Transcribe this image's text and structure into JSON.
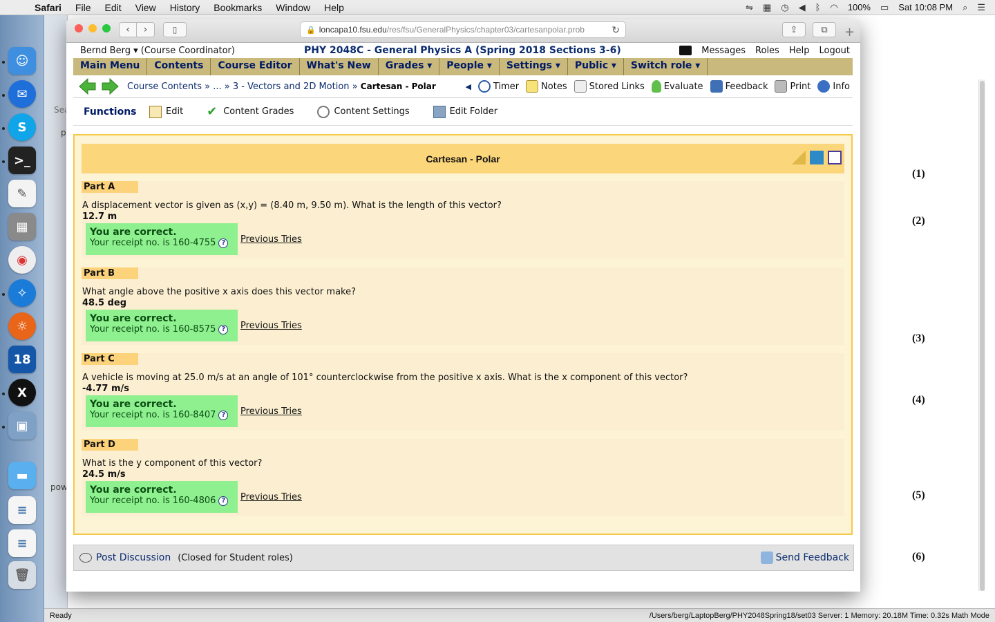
{
  "menubar": {
    "app": "Safari",
    "items": [
      "File",
      "Edit",
      "View",
      "History",
      "Bookmarks",
      "Window",
      "Help"
    ],
    "battery": "100%",
    "clock": "Sat 10:08 PM"
  },
  "background_window": {
    "left_fragments": [
      "Sea",
      "p",
      "pow"
    ],
    "equation_numbers": [
      "(1)",
      "(2)",
      "(3)",
      "(4)",
      "(5)",
      "(6)"
    ],
    "status_left": "Ready",
    "status_right": "/Users/berg/LaptopBerg/PHY2048Spring18/set03   Server: 1   Memory: 20.18M   Time: 0.32s   Math Mode"
  },
  "browser": {
    "url_host": "loncapa10.fsu.edu",
    "url_path": "/res/fsu/GeneralPhysics/chapter03/cartesanpolar.prob"
  },
  "header": {
    "user": "Bernd Berg ▾",
    "role": "(Course Coordinator)",
    "course": "PHY 2048C - General Physics A (Spring 2018 Sections 3-6)",
    "links": [
      "Messages",
      "Roles",
      "Help",
      "Logout"
    ]
  },
  "mainmenu": [
    "Main Menu",
    "Contents",
    "Course Editor",
    "What's New",
    "Grades ▾",
    "People ▾",
    "Settings ▾",
    "Public ▾",
    "Switch role ▾"
  ],
  "breadcrumbs": {
    "items": [
      "Course Contents",
      "...",
      "3 - Vectors and 2D Motion"
    ],
    "separator": "»",
    "current": "Cartesan - Polar"
  },
  "tools": [
    "Timer",
    "Notes",
    "Stored Links",
    "Evaluate",
    "Feedback",
    "Print",
    "Info"
  ],
  "functions": {
    "title": "Functions",
    "items": [
      "Edit",
      "Content Grades",
      "Content Settings",
      "Edit Folder"
    ]
  },
  "problem": {
    "title": "Cartesan - Polar",
    "correct_text": "You are correct.",
    "receipt_prefix": "Your receipt no. is",
    "previous_tries": "Previous Tries",
    "parts": [
      {
        "label": "Part A",
        "question": "A displacement vector is given as (x,y) = (8.40 m, 9.50 m). What is the length of this vector?",
        "answer": "12.7 m",
        "receipt": "160-4755"
      },
      {
        "label": "Part B",
        "question": "What angle above the positive x axis does this vector make?",
        "answer": "48.5 deg",
        "receipt": "160-8575"
      },
      {
        "label": "Part C",
        "question": "A vehicle is moving at 25.0 m/s at an angle of 101° counterclockwise from the positive x axis. What is the x component of this vector?",
        "answer": "-4.77 m/s",
        "receipt": "160-8407"
      },
      {
        "label": "Part D",
        "question": "What is the y component of this vector?",
        "answer": "24.5 m/s",
        "receipt": "160-4806"
      }
    ]
  },
  "footer": {
    "post": "Post Discussion",
    "closed": "(Closed for Student roles)",
    "send": "Send Feedback"
  },
  "colors": {
    "menu_bg": "#c9b97c",
    "problem_bg": "#fdf4d6",
    "problem_border": "#f5c947",
    "correct_bg": "#8ff090",
    "link_blue": "#0b2c6e"
  }
}
